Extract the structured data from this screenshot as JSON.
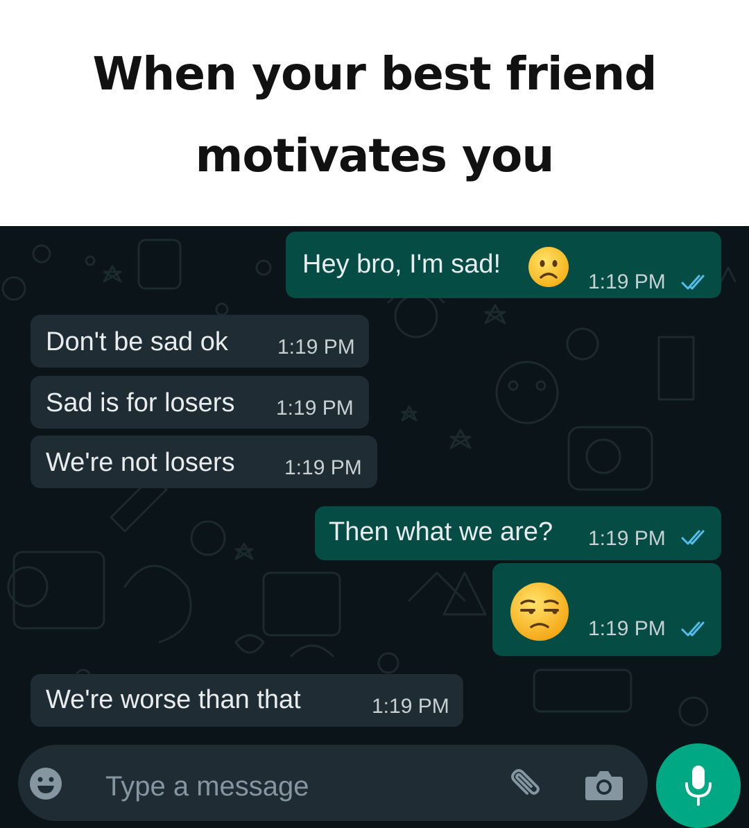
{
  "caption": {
    "line1": "When your best friend",
    "line2": "motivates you"
  },
  "colors": {
    "outgoing_bubble": "#054d44",
    "incoming_bubble": "#1f2c33",
    "chat_background": "#0b1418",
    "accent": "#00a884",
    "read_ticks": "#53bdeb"
  },
  "messages": [
    {
      "direction": "outgoing",
      "text": "Hey bro, I'm sad!",
      "emoji": "frowning-face",
      "time": "1:19 PM",
      "status": "read"
    },
    {
      "direction": "incoming",
      "text": "Don't be sad ok",
      "time": "1:19 PM"
    },
    {
      "direction": "incoming",
      "text": "Sad is for losers",
      "time": "1:19 PM"
    },
    {
      "direction": "incoming",
      "text": "We're not losers",
      "time": "1:19 PM"
    },
    {
      "direction": "outgoing",
      "text": "Then what we are?",
      "time": "1:19 PM",
      "status": "read"
    },
    {
      "direction": "outgoing",
      "text": "",
      "emoji": "unamused-face",
      "time": "1:19 PM",
      "status": "read"
    },
    {
      "direction": "incoming",
      "text": "We're worse than that",
      "time": "1:19 PM"
    }
  ],
  "composer": {
    "placeholder": "Type a message",
    "icons": [
      "emoji-icon",
      "attach-icon",
      "camera-icon",
      "mic-icon"
    ]
  }
}
